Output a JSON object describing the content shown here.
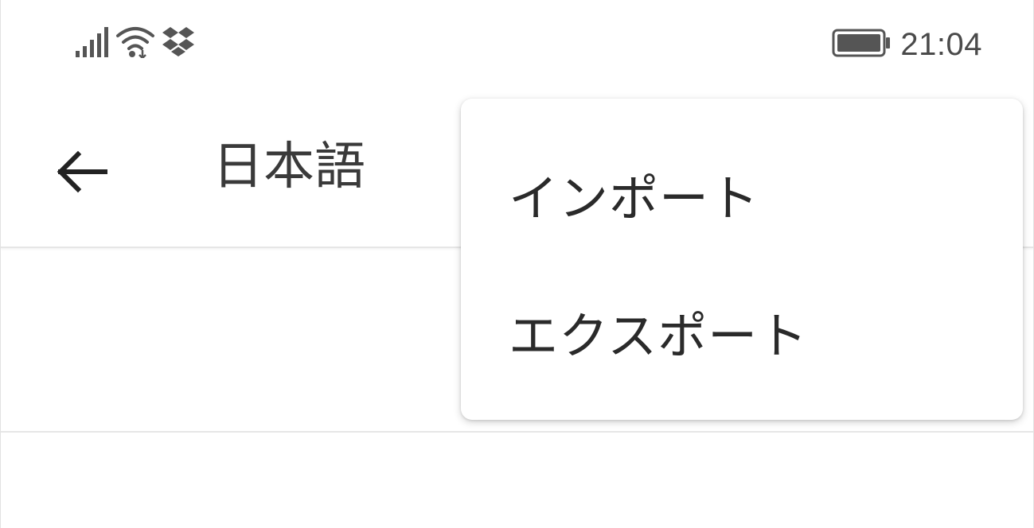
{
  "status_bar": {
    "time": "21:04",
    "icons": [
      "signal-icon",
      "wifi-icon",
      "dropbox-icon",
      "battery-icon"
    ]
  },
  "app_bar": {
    "back_icon": "arrow-left-icon",
    "title": "日本語"
  },
  "menu": {
    "items": [
      {
        "label": "インポート"
      },
      {
        "label": "エクスポート"
      }
    ]
  },
  "colors": {
    "text_primary": "#2a2a2a",
    "text_secondary": "#4a4a4a",
    "divider": "#e6e6e6",
    "background": "#ffffff"
  }
}
